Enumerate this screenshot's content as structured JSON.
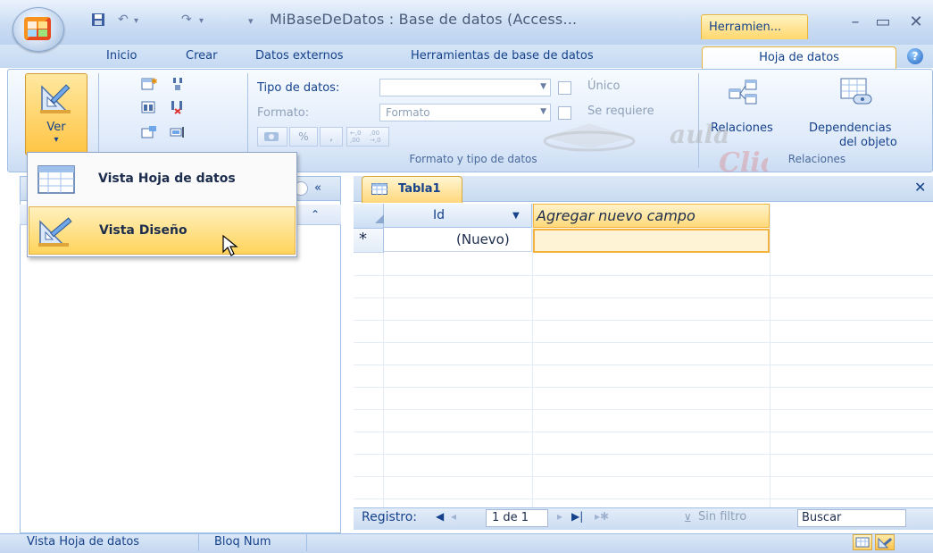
{
  "window": {
    "title": "MiBaseDeDatos : Base de datos (Access...",
    "context_tab": "Herramien..."
  },
  "ribbon": {
    "tabs": [
      "Inicio",
      "Crear",
      "Datos externos",
      "Herramientas de base de datos",
      "Hoja de datos"
    ],
    "ver_label": "Ver",
    "tipo_datos_label": "Tipo de datos:",
    "formato_label": "Formato:",
    "formato_value": "Formato",
    "unico_label": "Único",
    "se_requiere_label": "Se requiere",
    "group_formato": "Formato y tipo de datos",
    "relaciones_label": "Relaciones",
    "dependencias_label": "Dependencias",
    "del_objeto_label": "del objeto",
    "group_relaciones": "Relaciones",
    "percent_label": "%",
    "comma_label": ",",
    "dec_inc_label": "+,0\n,00",
    "dec_dec_label": ",00\n+,0"
  },
  "menu": {
    "items": [
      {
        "label": "Vista Hoja de datos"
      },
      {
        "label": "Vista Diseño"
      }
    ]
  },
  "table": {
    "tab_label": "Tabla1",
    "columns": [
      {
        "label": "Id"
      },
      {
        "label": "Agregar nuevo campo"
      }
    ],
    "new_row_value": "(Nuevo)",
    "new_row_marker": "*"
  },
  "record_nav": {
    "label": "Registro:",
    "position": "1 de 1",
    "filter": "Sin filtro",
    "search_placeholder": "Buscar"
  },
  "statusbar": {
    "left_text": "Vista Hoja de datos",
    "mode": "Bloq Num"
  },
  "watermark": "aula Clic",
  "colors": {
    "accent": "#ffd45c",
    "title_bar": "#c9dcf3",
    "text": "#15428b"
  }
}
